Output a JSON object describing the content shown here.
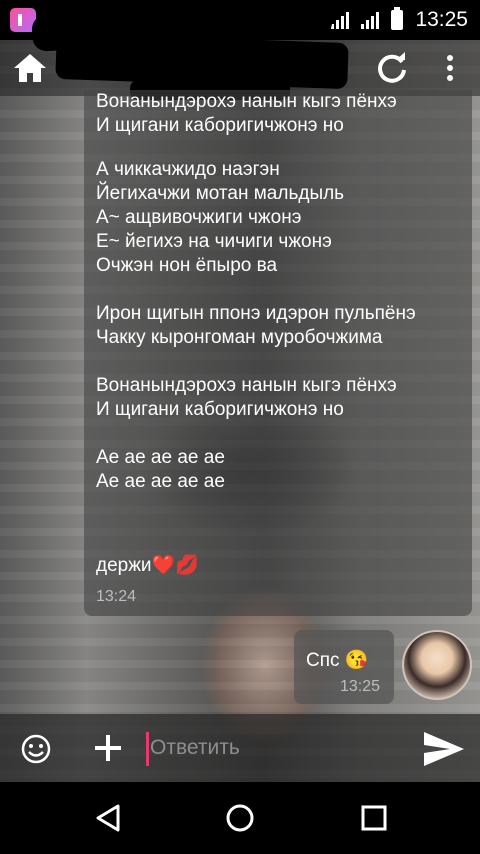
{
  "status_bar": {
    "time": "13:25"
  },
  "app_bar": {
    "home_icon": "home-icon",
    "refresh_icon": "refresh-icon",
    "more_icon": "more-vertical-icon"
  },
  "messages": [
    {
      "side": "left",
      "blocks": [
        [
          "Вонанындэрохэ нанын кыгэ пёнхэ",
          "И щигани каборигичжонэ но"
        ],
        [
          "А чиккачжидо наэгэн",
          "Йегихачжи мотан мальдыль",
          "А~ ащвивочжиги чжонэ",
          "Е~ йегихэ на чичиги чжонэ",
          "Очжэн нон ёпыро ва"
        ],
        [
          "Ирон щигын ппонэ идэрон пульпёнэ",
          "Чакку кыронгоман муробочжима"
        ],
        [
          "Вонанындэрохэ нанын кыгэ пёнхэ",
          "И щигани каборигичжонэ но"
        ],
        [
          "Ае ае ае ае ае",
          "Ае ае ае ае ае"
        ],
        [
          "держи❤️💋"
        ]
      ],
      "time": "13:24"
    },
    {
      "side": "right",
      "text": "Спс 😘",
      "time": "13:25"
    }
  ],
  "composer": {
    "placeholder": "Ответить",
    "emoji_icon": "emoji-icon",
    "plus_icon": "plus-icon",
    "send_icon": "send-icon"
  },
  "nav_bar": {
    "back_icon": "back-icon",
    "home_icon": "home-circle-icon",
    "recent_icon": "recent-apps-icon"
  },
  "colors": {
    "caret": "#e9386b",
    "bubble_left": "#464646",
    "bubble_right": "#555555"
  }
}
